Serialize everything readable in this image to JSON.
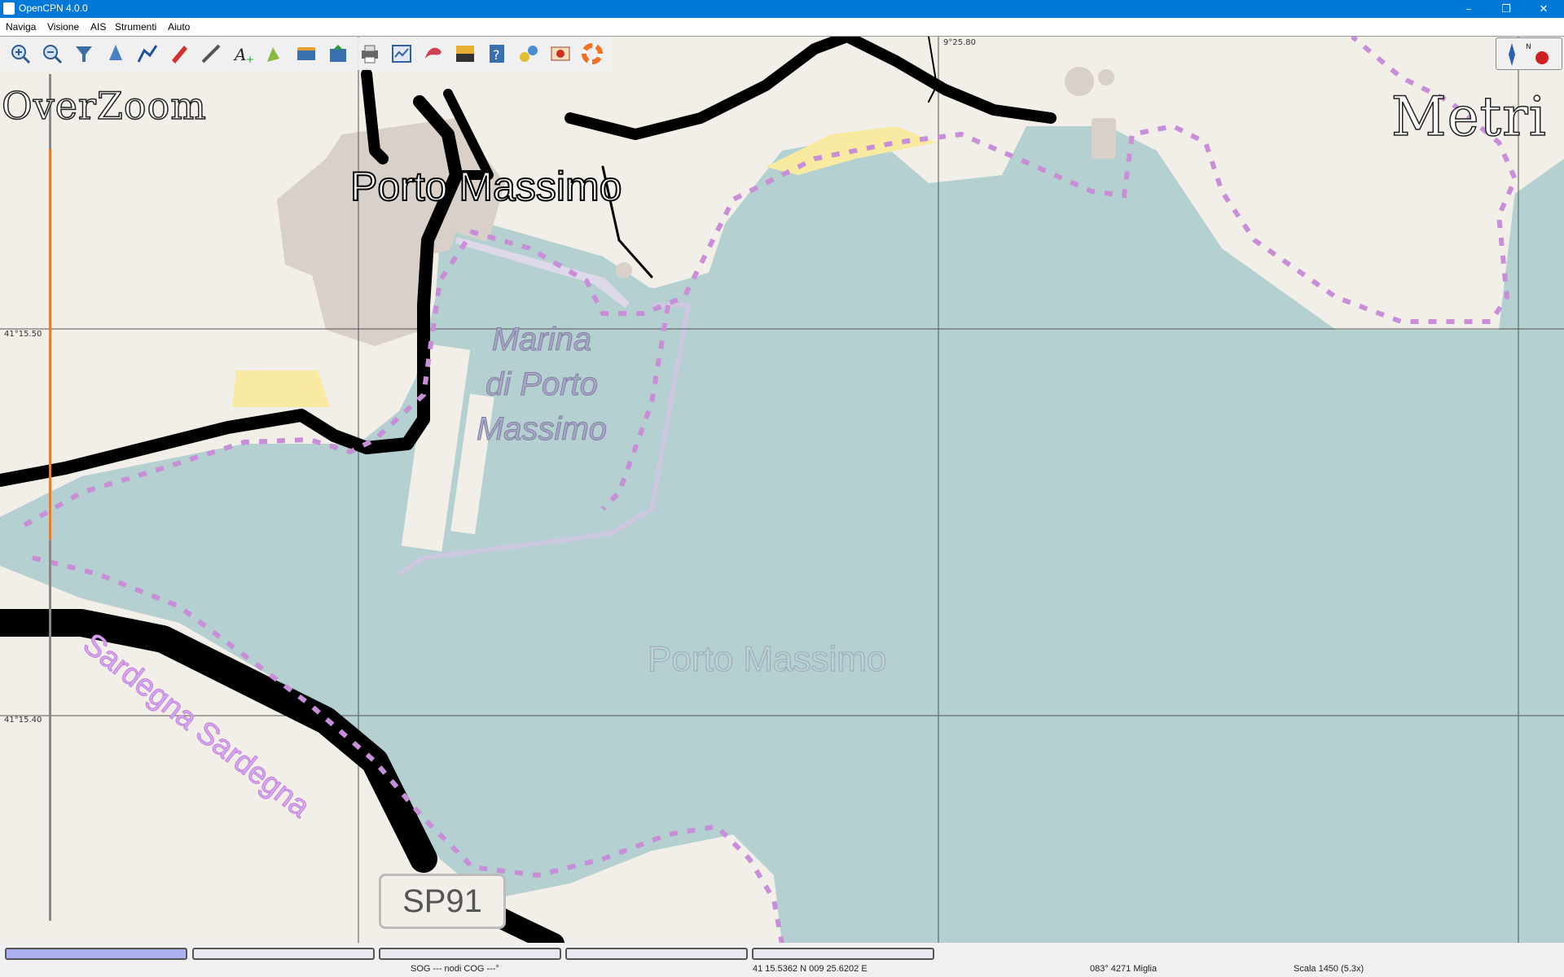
{
  "window": {
    "title": "OpenCPN 4.0.0",
    "minimize": "–",
    "restore": "❐",
    "close": "✕"
  },
  "menu": {
    "items": [
      "Naviga",
      "Visione",
      "AIS",
      "Strumenti",
      "Aiuto"
    ]
  },
  "toolbar": {
    "buttons": [
      "zoom-in-icon",
      "zoom-out-icon",
      "filter-icon",
      "ais-icon",
      "route-icon",
      "track-icon",
      "measure-icon",
      "text-icon",
      "mark-icon",
      "chart-icon",
      "layers-icon",
      "print-icon",
      "settings-icon",
      "palette-icon",
      "tide-icon",
      "help-icon",
      "plugin-icon",
      "mob-icon",
      "lifering-icon"
    ]
  },
  "overlays": {
    "overzoom": "OverZoom",
    "units": "Metri"
  },
  "map": {
    "lat_labels": [
      "41°15.50",
      "41°15.40"
    ],
    "lon_label": "9°25.80",
    "town_label": "Porto Massimo",
    "marina_label": [
      "Marina",
      "di Porto",
      "Massimo"
    ],
    "bay_label": "Porto Massimo",
    "road_label": "Sardegna Sardegna",
    "road_shield": "SP91",
    "colors": {
      "water": "#b5d0d0",
      "land": "#f2efe9",
      "road": "#000000",
      "boundary": "#c88fd8",
      "beach": "#f8eaa0",
      "buildings": "#d9d0c9"
    }
  },
  "statusbar": {
    "sog_cog": "SOG --- nodi COG ---°",
    "position": "41 15.5362 N   009 25.6202 E",
    "bearing": "083°  4271 Miglia",
    "scale": "Scala 1450 (5.3x)",
    "progress_active_index": 0
  }
}
